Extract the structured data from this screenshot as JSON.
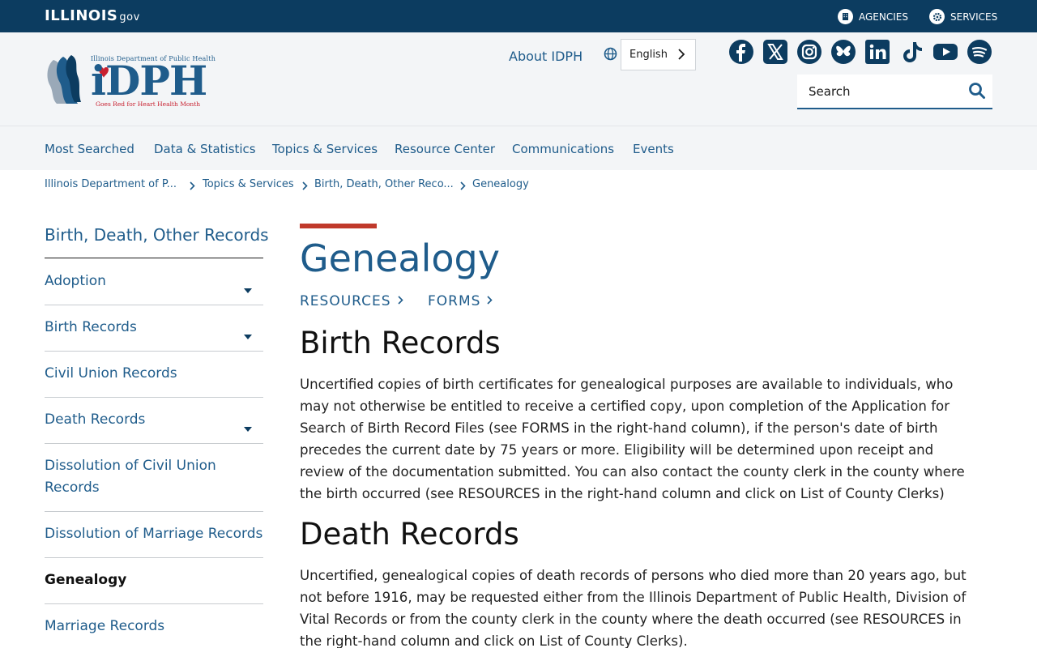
{
  "topbar": {
    "logo_text": "ILLINOIS",
    "logo_suffix": "gov",
    "agencies": "AGENCIES",
    "services": "SERVICES"
  },
  "header": {
    "logo_line1": "Illinois Department of Public Health",
    "logo_main": "iDPH",
    "logo_line2": "Goes Red for Heart Health Month",
    "about": "About IDPH",
    "language": "English",
    "search_placeholder": "Search",
    "social": [
      "facebook",
      "x",
      "instagram",
      "bluesky",
      "linkedin",
      "tiktok",
      "youtube",
      "spotify"
    ]
  },
  "nav": [
    "Most Searched",
    "Data & Statistics",
    "Topics & Services",
    "Resource Center",
    "Communications",
    "Events"
  ],
  "breadcrumb": [
    "Illinois Department of P...",
    "Topics & Services",
    "Birth, Death, Other Reco...",
    "Genealogy"
  ],
  "sidebar": {
    "title": "Birth, Death, Other Records",
    "items": [
      {
        "label": "Adoption",
        "expandable": true
      },
      {
        "label": "Birth Records",
        "expandable": true
      },
      {
        "label": "Civil Union Records",
        "expandable": false
      },
      {
        "label": "Death Records",
        "expandable": true
      },
      {
        "label": "Dissolution of Civil Union Records",
        "expandable": false
      },
      {
        "label": "Dissolution of Marriage Records",
        "expandable": false
      },
      {
        "label": "Genealogy",
        "expandable": false,
        "active": true
      },
      {
        "label": "Marriage Records",
        "expandable": false
      }
    ]
  },
  "main": {
    "title": "Genealogy",
    "tabs": [
      "RESOURCES",
      "FORMS"
    ],
    "sections": [
      {
        "heading": "Birth Records",
        "text": "Uncertified copies of birth certificates for genealogical purposes are available to individuals, who may not otherwise be entitled to receive a certified copy, upon completion of the Application for Search of Birth Record Files (see  FORMS in the right-hand column), if the person's date of birth precedes the current date by 75 years or more. Eligibility will be determined upon receipt and review of the documentation submitted. You can also contact the county clerk in the county where the birth occurred (see RESOURCES in the right-hand column and click on List of County Clerks)"
      },
      {
        "heading": "Death Records",
        "text": "Uncertified, genealogical copies of death records of persons who died more than 20 years ago, but not before 1916, may be requested either from the Illinois Department of Public Health, Division of Vital Records or from the county clerk in the county where the death occurred (see RESOURCES in the right-hand column and click on List of County Clerks)."
      }
    ]
  },
  "colors": {
    "navy": "#0c3c60",
    "link_blue": "#1f5c8b",
    "accent_red": "#c0392b"
  }
}
